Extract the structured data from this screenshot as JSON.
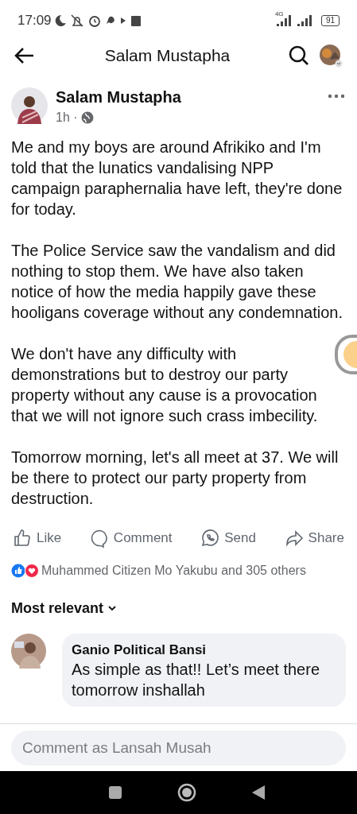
{
  "status_bar": {
    "time": "17:09",
    "network": "4G",
    "battery": "91"
  },
  "header": {
    "title": "Salam Mustapha"
  },
  "post": {
    "author": "Salam Mustapha",
    "time": "1h ·",
    "paragraphs": [
      "Me and my boys are around Afrikiko and I'm told that the lunatics vandalising NPP campaign paraphernalia have left, they're done for today.",
      "The Police Service saw the vandalism and did nothing to stop them. We have also taken notice of how the media happily gave these hooligans coverage without any condemnation.",
      "We don't have any difficulty with demonstrations but to destroy our party property without any cause is a provocation that we will not ignore such crass imbecility.",
      "Tomorrow morning, let's all meet at 37. We will be there to protect our party property from destruction."
    ],
    "actions": [
      {
        "kind": "like",
        "label": "Like"
      },
      {
        "kind": "comment",
        "label": "Comment"
      },
      {
        "kind": "send",
        "label": "Send"
      },
      {
        "kind": "share",
        "label": "Share"
      }
    ],
    "reactions": "Muhammed Citizen Mo Yakubu and 305 others"
  },
  "sort": {
    "label": "Most relevant"
  },
  "comments": [
    {
      "author": "Ganio Political Bansi",
      "text": "As simple as that!! Let’s meet there tomorrow inshallah"
    }
  ],
  "comment_field": {
    "placeholder": "Comment as Lansah Musah"
  }
}
